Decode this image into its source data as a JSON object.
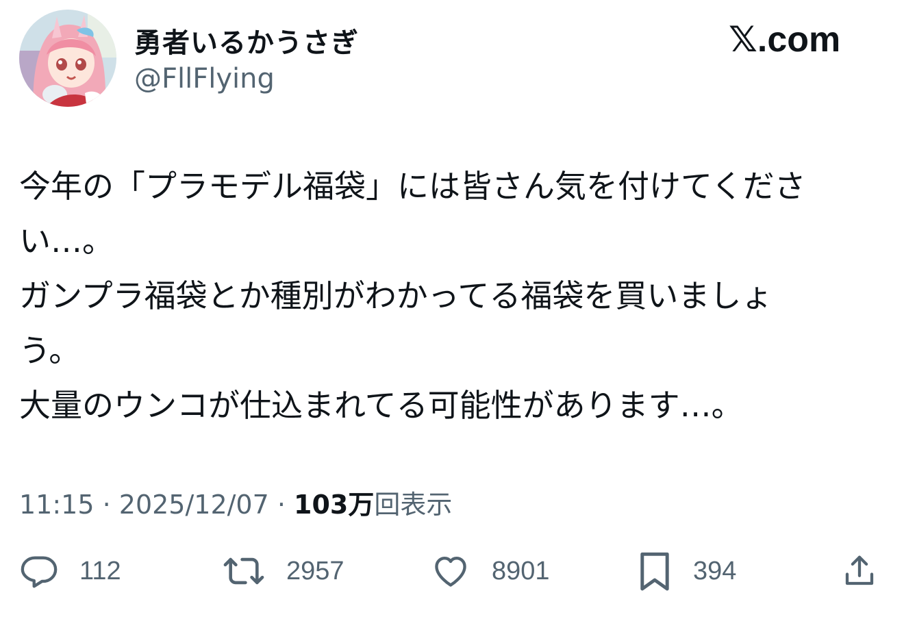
{
  "header": {
    "display_name": "勇者いるかうさぎ",
    "handle": "@FllFlying",
    "brand": "𝕏.com"
  },
  "tweet": {
    "lines": [
      "今年の「プラモデル福袋」には皆さん気を付けてくださ",
      "い…。",
      "ガンプラ福袋とか種別がわかってる福袋を買いましょ",
      "う。",
      "大量のウンコが仕込まれてる可能性があります…。"
    ]
  },
  "meta": {
    "time": "11:15",
    "separator": " · ",
    "date": "2025/12/07",
    "views_count": "103万",
    "views_label": "回表示"
  },
  "actions": {
    "replies": "112",
    "retweets": "2957",
    "likes": "8901",
    "bookmarks": "394"
  },
  "colors": {
    "text": "#0f1419",
    "secondary": "#536471",
    "background": "#ffffff"
  },
  "icons": [
    "reply-icon",
    "retweet-icon",
    "like-icon",
    "bookmark-icon",
    "share-icon"
  ]
}
